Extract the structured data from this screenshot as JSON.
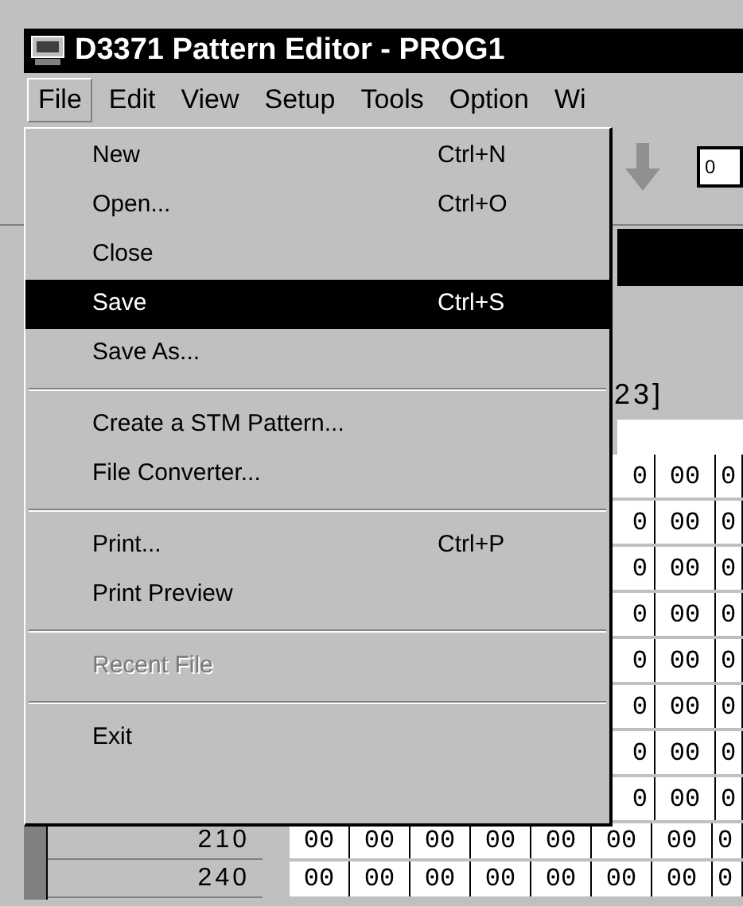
{
  "window": {
    "title": "D3371 Pattern Editor - PROG1"
  },
  "menu_bar": [
    {
      "label": "File",
      "selected": true
    },
    {
      "label": "Edit",
      "selected": false
    },
    {
      "label": "View",
      "selected": false
    },
    {
      "label": "Setup",
      "selected": false
    },
    {
      "label": "Tools",
      "selected": false
    },
    {
      "label": "Option",
      "selected": false
    },
    {
      "label": "Wi",
      "selected": false
    }
  ],
  "file_menu": [
    {
      "kind": "item",
      "label": "New",
      "shortcut": "Ctrl+N",
      "selected": false,
      "disabled": false
    },
    {
      "kind": "item",
      "label": "Open...",
      "shortcut": "Ctrl+O",
      "selected": false,
      "disabled": false
    },
    {
      "kind": "item",
      "label": "Close",
      "selected": false,
      "disabled": false
    },
    {
      "kind": "item",
      "label": "Save",
      "shortcut": "Ctrl+S",
      "selected": true,
      "disabled": false
    },
    {
      "kind": "item",
      "label": "Save As...",
      "selected": false,
      "disabled": false
    },
    {
      "kind": "separator"
    },
    {
      "kind": "item",
      "label": "Create a STM Pattern...",
      "selected": false,
      "disabled": false
    },
    {
      "kind": "item",
      "label": "File Converter...",
      "selected": false,
      "disabled": false
    },
    {
      "kind": "separator"
    },
    {
      "kind": "item",
      "label": "Print...",
      "shortcut": "Ctrl+P",
      "selected": false,
      "disabled": false
    },
    {
      "kind": "item",
      "label": "Print Preview",
      "selected": false,
      "disabled": false
    },
    {
      "kind": "separator"
    },
    {
      "kind": "item",
      "label": "Recent File",
      "selected": false,
      "disabled": true
    },
    {
      "kind": "separator"
    },
    {
      "kind": "item",
      "label": "Exit",
      "selected": false,
      "disabled": false
    }
  ],
  "toolbar": {
    "field_value": "0"
  },
  "header_fragment": "23]",
  "grid_rows": [
    {
      "kind": "covered",
      "cells": [
        "0",
        "00",
        "0"
      ]
    },
    {
      "kind": "covered",
      "cells": [
        "0",
        "00",
        "0"
      ]
    },
    {
      "kind": "covered",
      "cells": [
        "0",
        "00",
        "0"
      ]
    },
    {
      "kind": "covered",
      "cells": [
        "0",
        "00",
        "0"
      ]
    },
    {
      "kind": "covered",
      "cells": [
        "0",
        "00",
        "0"
      ]
    },
    {
      "kind": "covered",
      "cells": [
        "0",
        "00",
        "0"
      ]
    },
    {
      "kind": "covered",
      "cells": [
        "0",
        "00",
        "0"
      ]
    },
    {
      "kind": "covered",
      "cells": [
        "0",
        "00",
        "0"
      ]
    },
    {
      "kind": "full",
      "label": "210",
      "cells": [
        "00",
        "00",
        "00",
        "00",
        "00",
        "00",
        "00",
        "0"
      ]
    },
    {
      "kind": "full",
      "label": "240",
      "cells": [
        "00",
        "00",
        "00",
        "00",
        "00",
        "00",
        "00",
        "0"
      ]
    }
  ]
}
